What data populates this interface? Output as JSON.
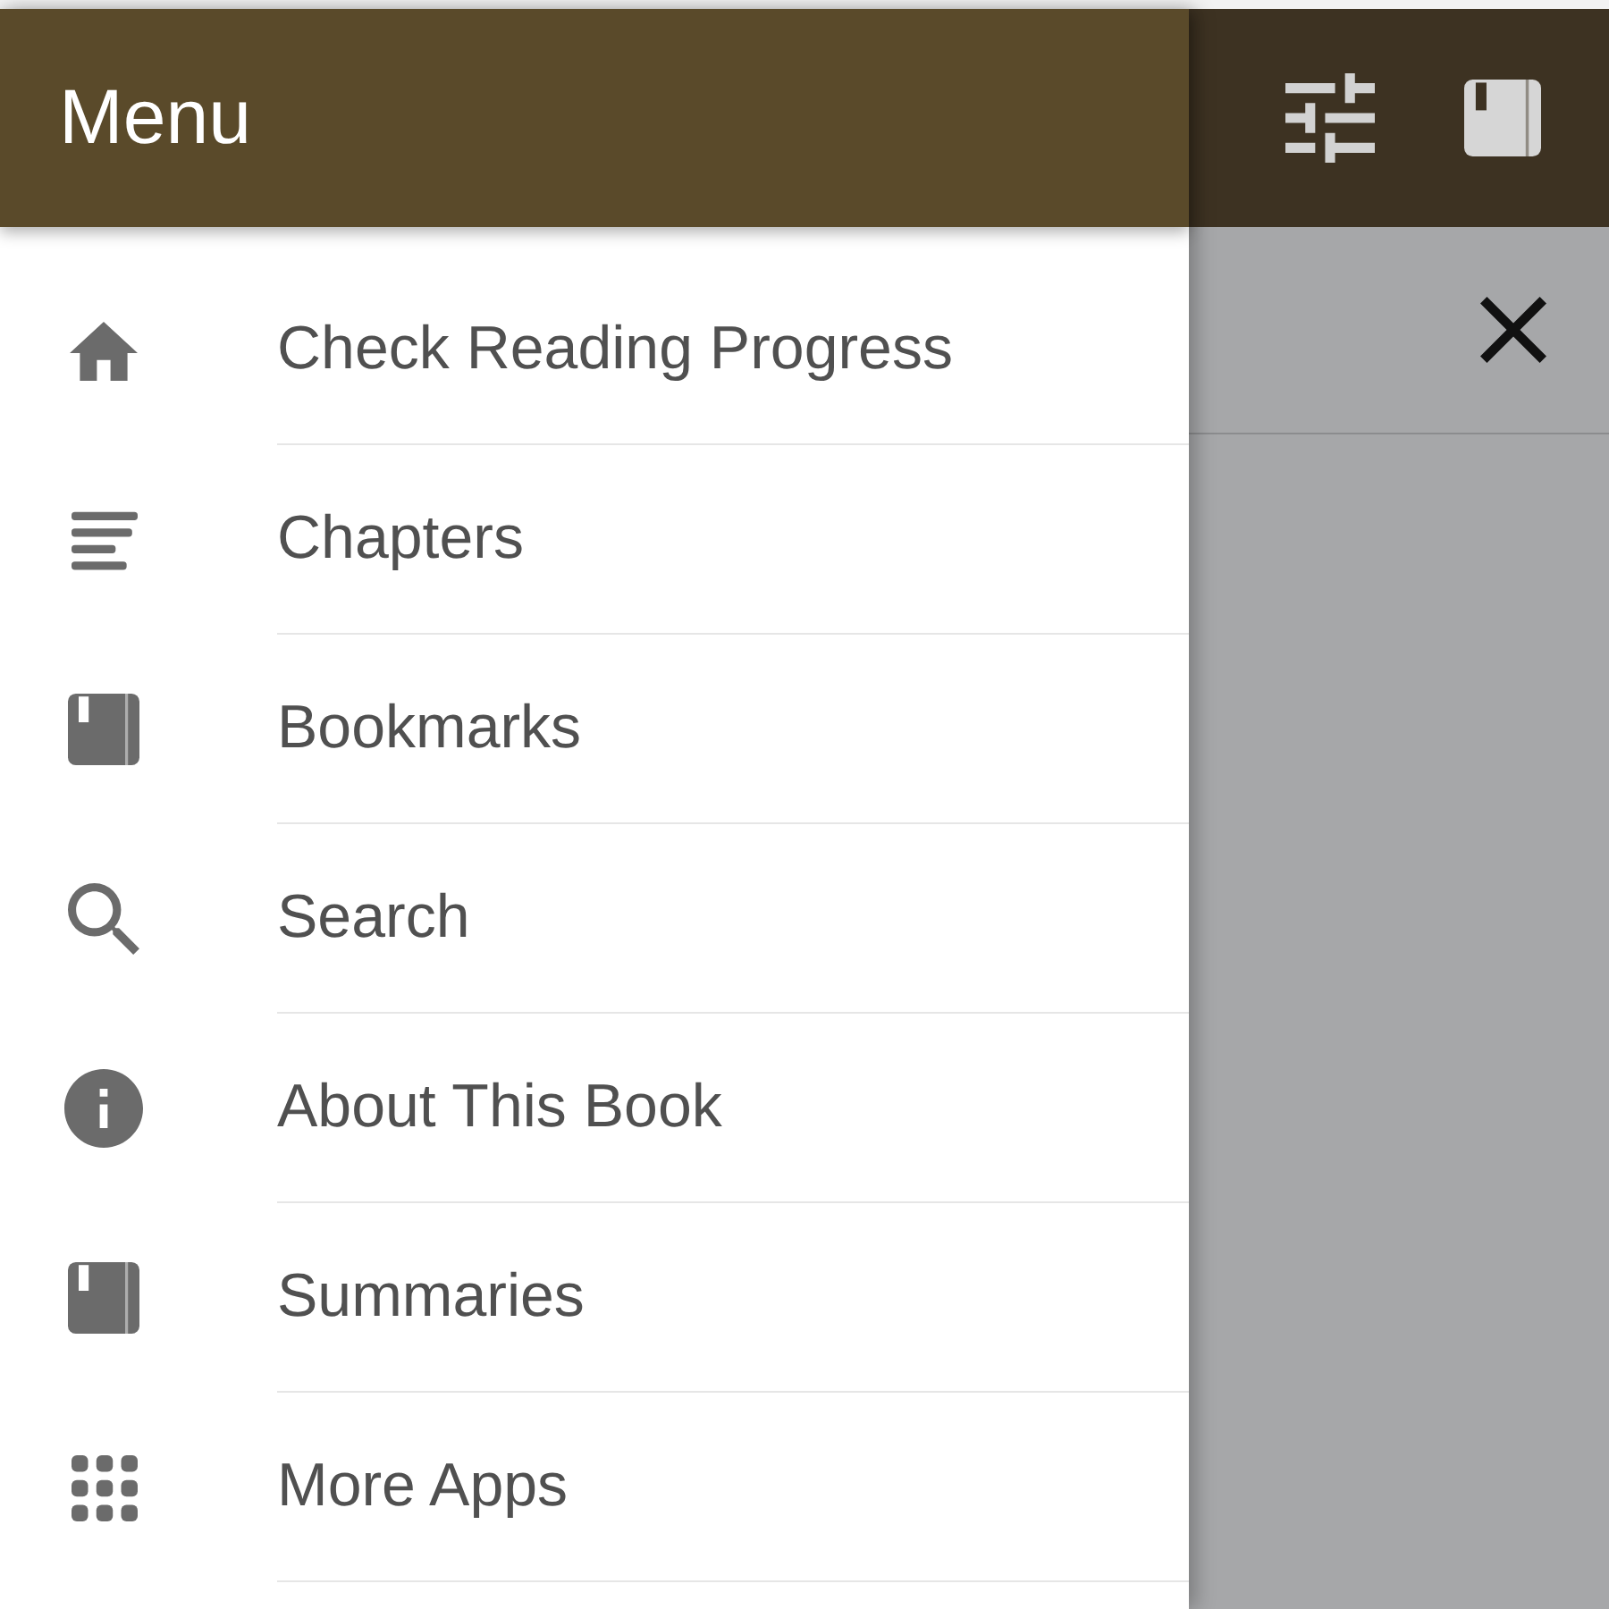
{
  "header": {
    "title": "Menu"
  },
  "menu": {
    "items": [
      {
        "label": "Check Reading Progress"
      },
      {
        "label": "Chapters"
      },
      {
        "label": "Bookmarks"
      },
      {
        "label": "Search"
      },
      {
        "label": "About This Book"
      },
      {
        "label": "Summaries"
      },
      {
        "label": "More Apps"
      }
    ]
  }
}
